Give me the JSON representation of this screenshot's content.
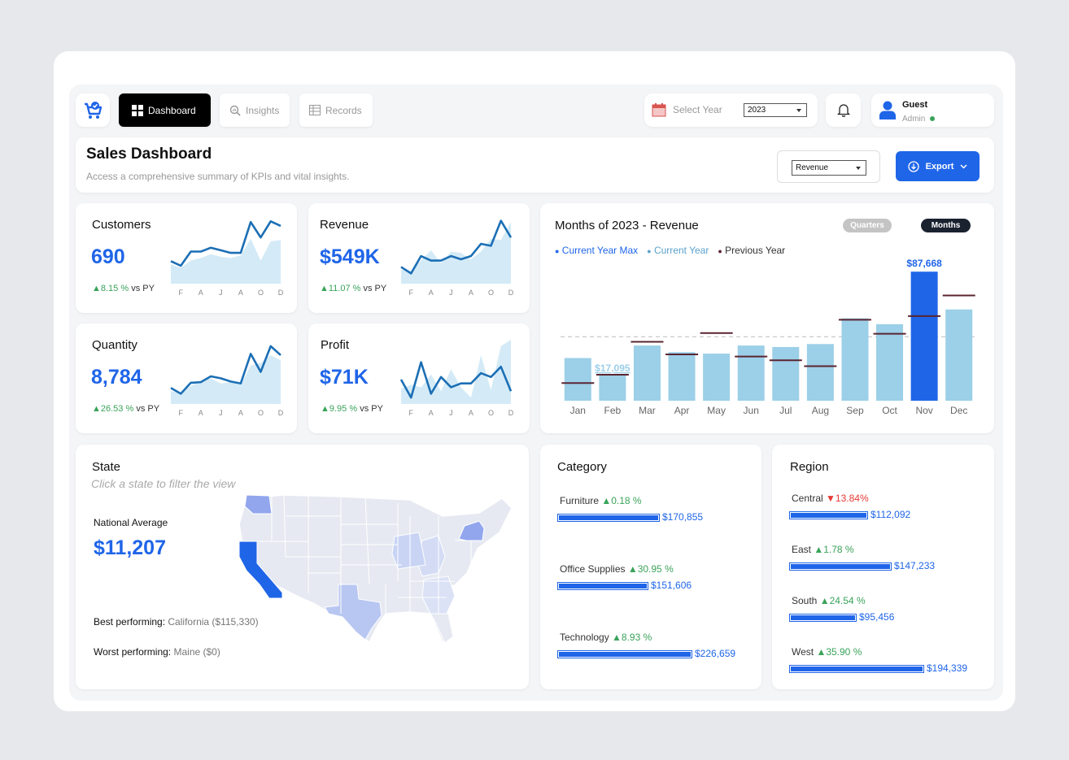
{
  "nav": {
    "dashboard": "Dashboard",
    "insights": "Insights",
    "records": "Records"
  },
  "year_filter": {
    "label": "Select Year",
    "value": "2023"
  },
  "user": {
    "name": "Guest",
    "role": "Admin",
    "status_color": "#3aa35a"
  },
  "header": {
    "title": "Sales Dashboard",
    "subtitle": "Access a comprehensive summary of KPIs and vital insights.",
    "measure": "Revenue",
    "export": "Export"
  },
  "spark_months": [
    "F",
    "A",
    "J",
    "A",
    "O",
    "D"
  ],
  "kpis": [
    {
      "title": "Customers",
      "value": "690",
      "change": "▲8.15 %",
      "vs": "vs PY",
      "cy": [
        3.5,
        2.8,
        5.0,
        5.0,
        5.6,
        5.2,
        4.8,
        4.8,
        9.6,
        7.2,
        9.7,
        9.0
      ],
      "py": [
        3.0,
        2.5,
        3.6,
        4.0,
        4.6,
        4.2,
        4.0,
        4.4,
        7.0,
        3.6,
        6.6,
        6.8
      ]
    },
    {
      "title": "Revenue",
      "value": "$549K",
      "change": "▲11.07 %",
      "vs": "vs PY",
      "cy": [
        2.6,
        1.6,
        4.3,
        3.6,
        3.6,
        4.3,
        3.8,
        4.3,
        6.2,
        5.9,
        9.8,
        7.2
      ],
      "py": [
        2.2,
        2.0,
        3.6,
        5.2,
        3.2,
        5.0,
        4.8,
        3.8,
        5.0,
        7.0,
        6.8,
        9.6
      ]
    },
    {
      "title": "Quantity",
      "value": "8,784",
      "change": "▲26.53 %",
      "vs": "vs PY",
      "cy": [
        2.5,
        1.6,
        3.3,
        3.4,
        4.3,
        4.0,
        3.5,
        3.2,
        7.8,
        5.0,
        9.0,
        7.6
      ],
      "py": [
        2.0,
        1.8,
        2.8,
        3.6,
        4.0,
        3.2,
        3.4,
        3.0,
        6.0,
        6.4,
        7.6,
        6.8
      ]
    },
    {
      "title": "Profit",
      "value": "$71K",
      "change": "▲9.95 %",
      "vs": "vs PY",
      "cy": [
        3.8,
        1.0,
        6.5,
        1.6,
        4.2,
        2.6,
        3.2,
        3.2,
        4.8,
        4.2,
        5.8,
        2.0
      ],
      "py": [
        2.4,
        3.0,
        2.6,
        4.6,
        2.0,
        5.4,
        2.6,
        1.0,
        7.6,
        2.2,
        9.0,
        10.0
      ]
    }
  ],
  "monthly_title": "Months of 2023 - Revenue",
  "monthly_toggle": {
    "quarters": "Quarters",
    "months": "Months"
  },
  "chart_data": {
    "type": "bar",
    "title": "Months of 2023 - Revenue",
    "categories": [
      "Jan",
      "Feb",
      "Mar",
      "Apr",
      "May",
      "Jun",
      "Jul",
      "Aug",
      "Sep",
      "Oct",
      "Nov",
      "Dec"
    ],
    "series": [
      {
        "name": "Current Year",
        "values": [
          29000,
          17095,
          37500,
          33000,
          32000,
          37500,
          36500,
          38500,
          56000,
          52000,
          87668,
          62000
        ]
      },
      {
        "name": "Previous Year",
        "values": [
          12000,
          17700,
          40000,
          31500,
          46000,
          30000,
          27500,
          23500,
          55000,
          45500,
          57500,
          71500
        ]
      }
    ],
    "average": 43500,
    "highlight": {
      "max_index": 10,
      "min_index": 1
    },
    "ylim": [
      0,
      90000
    ],
    "legend_position": "top-left",
    "colors": {
      "bar": "#9ccfe8",
      "max": "#1f65e8",
      "prev": "#5a2530"
    },
    "labels": {
      "max": "$87,668",
      "min": "$17,095"
    }
  },
  "monthly_legend": {
    "max": "Current Year Max",
    "current": "Current Year",
    "previous": "Previous Year"
  },
  "state": {
    "title": "State",
    "subtitle": "Click a state to filter the view",
    "avg_label": "National Average",
    "avg_value": "$11,207",
    "best_label": "Best performing:",
    "best_value": "California ($115,330)",
    "worst_label": "Worst performing:",
    "worst_value": "Maine ($0)"
  },
  "category": {
    "title": "Category",
    "items": [
      {
        "name": "Furniture",
        "change": "▲0.18 %",
        "value": "$170,855",
        "amount": 170855,
        "up": true
      },
      {
        "name": "Office Supplies",
        "change": "▲30.95 %",
        "value": "$151,606",
        "amount": 151606,
        "up": true
      },
      {
        "name": "Technology",
        "change": "▲8.93 %",
        "value": "$226,659",
        "amount": 226659,
        "up": true
      }
    ]
  },
  "region": {
    "title": "Region",
    "items": [
      {
        "name": "Central",
        "change": "▼13.84%",
        "value": "$112,092",
        "amount": 112092,
        "up": false
      },
      {
        "name": "East",
        "change": "▲1.78 %",
        "value": "$147,233",
        "amount": 147233,
        "up": true
      },
      {
        "name": "South",
        "change": "▲24.54 %",
        "value": "$95,456",
        "amount": 95456,
        "up": true
      },
      {
        "name": "West",
        "change": "▲35.90 %",
        "value": "$194,339",
        "amount": 194339,
        "up": true
      }
    ]
  }
}
